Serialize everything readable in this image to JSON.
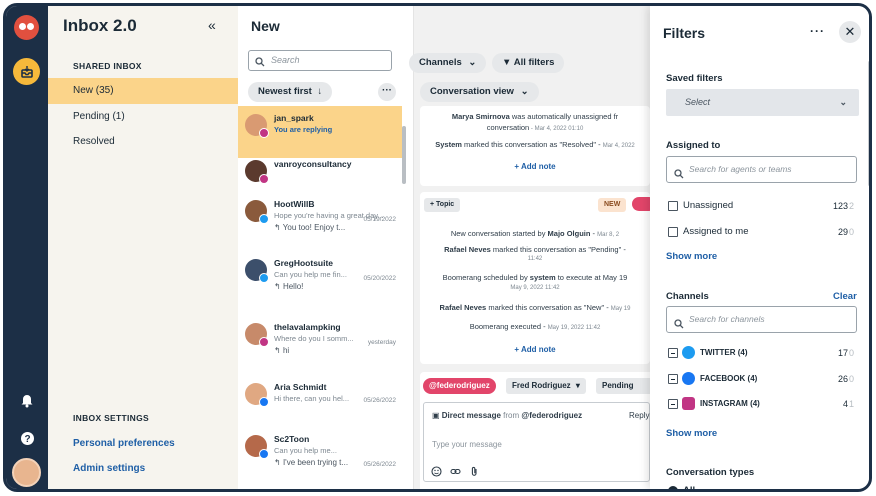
{
  "nav": {
    "title": "Inbox 2.0",
    "collapse_icon": "«",
    "shared_inbox_label": "SHARED INBOX",
    "items": [
      {
        "label": "New (35)",
        "active": true
      },
      {
        "label": "Pending (1)",
        "active": false
      },
      {
        "label": "Resolved",
        "active": false
      }
    ],
    "settings_label": "INBOX SETTINGS",
    "links": [
      "Personal preferences",
      "Admin settings"
    ]
  },
  "list": {
    "title": "New",
    "search_placeholder": "Search",
    "sort_label": "Newest first",
    "sort_arrow": "↓",
    "more_label": "···",
    "conversations": [
      {
        "name": "jan_spark",
        "status": "You are replying",
        "avatar_color": "#d99a72",
        "badge_color": "#c13584",
        "active": true
      },
      {
        "name": "vanroyconsultancy",
        "avatar_color": "#5b3a2e",
        "badge_color": "#c13584"
      },
      {
        "name": "HootWillB",
        "snippet": "Hope you're having a great day...",
        "last": "You too! Enjoy t...",
        "date": "05/19/2022",
        "avatar_color": "#8a5a3c",
        "badge_color": "#1d9bf0"
      },
      {
        "name": "GregHootsuite",
        "snippet": "Can you help me fin...",
        "last": "Hello!",
        "date": "05/20/2022",
        "avatar_color": "#3c4f6b",
        "badge_color": "#1d9bf0"
      },
      {
        "name": "thelavalampking",
        "snippet": "Where do you I somm...",
        "last": "hi",
        "date": "yesterday",
        "avatar_color": "#c78a6a",
        "badge_color": "#c13584"
      },
      {
        "name": "Aria Schmidt",
        "snippet": "Hi there, can you hel...",
        "date": "05/26/2022",
        "avatar_color": "#e0a882",
        "badge_color": "#1877f2"
      },
      {
        "name": "Sc2Toon",
        "snippet": "Can you help me...",
        "last": "I've been trying t...",
        "date": "05/26/2022",
        "avatar_color": "#b5694a",
        "badge_color": "#1877f2"
      }
    ]
  },
  "main": {
    "title": "New",
    "channels_label": "Channels",
    "all_filters_label": "All filters",
    "view_label": "Conversation view",
    "thread1": {
      "events": [
        {
          "bold": "Marya Smirnova",
          "text": " was automatically unassigned fr",
          "line2": "conversation",
          "time": "Mar 4, 2022 01:10"
        },
        {
          "bold": "System",
          "text": " marked this conversation as \"Resolved\"",
          "time": "Mar 4, 2022"
        }
      ],
      "add_note": "+ Add note"
    },
    "thread2": {
      "topic": "+ Topic",
      "new_tag": "NEW",
      "events": [
        {
          "pre": "New conversation started by ",
          "bold": "Majo Olguin",
          "time": "Mar 8, 2"
        },
        {
          "bold": "Rafael Neves",
          "text": " marked this conversation as \"Pending\"",
          "time": "11:42"
        },
        {
          "pre": "Boomerang scheduled by ",
          "bold": "system",
          "text": " to execute at May 19",
          "time": "May 9, 2022 11:42"
        },
        {
          "bold": "Rafael Neves",
          "text": " marked this conversation as \"New\"",
          "time": "May 19"
        },
        {
          "pre": "Boomerang  executed",
          "time": "May 19, 2022 11:42"
        }
      ],
      "add_note": "+ Add note"
    },
    "composer": {
      "handle_chip": "@federodriguez",
      "assignee": "Fred Rodriguez",
      "status": "Pending",
      "dm_label": "Direct message",
      "from_text": "from",
      "from_handle": "@federodriguez",
      "reply_label": "Reply",
      "placeholder": "Type your message"
    }
  },
  "filters": {
    "title": "Filters",
    "more": "···",
    "close": "✕",
    "saved_filters_label": "Saved filters",
    "saved_select": "Select",
    "assigned_to_label": "Assigned to",
    "assigned_search_placeholder": "Search for agents or teams",
    "assigned_options": [
      {
        "label": "Unassigned",
        "count": "123",
        "dim": "2"
      },
      {
        "label": "Assigned to me",
        "count": "29",
        "dim": "0"
      }
    ],
    "show_more": "Show more",
    "channels_label": "Channels",
    "clear_label": "Clear",
    "channel_search_placeholder": "Search for channels",
    "channels": [
      {
        "label": "TWITTER (4)",
        "count": "17",
        "dim": "0",
        "color": "#1d9bf0"
      },
      {
        "label": "FACEBOOK (4)",
        "count": "26",
        "dim": "0",
        "color": "#1877f2"
      },
      {
        "label": "INSTAGRAM (4)",
        "count": "4",
        "dim": "1",
        "color": "#c13584"
      }
    ],
    "show_more_2": "Show more",
    "conversation_types_label": "Conversation types",
    "all_label": "All"
  },
  "colors": {
    "rail": "#1c2f46",
    "accent": "#fbd48a",
    "link": "#1f5fa6",
    "brand_owl": "#e1503f"
  }
}
